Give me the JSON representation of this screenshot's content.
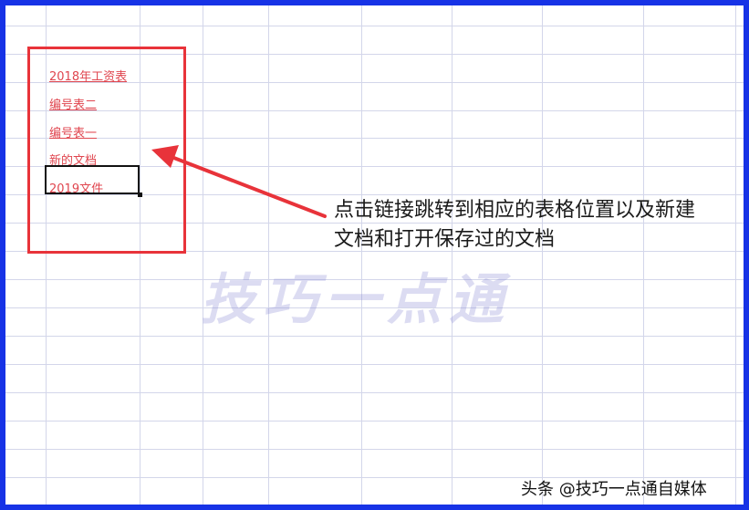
{
  "sheet": {
    "links": [
      {
        "label": "2018年工资表"
      },
      {
        "label": "编号表二"
      },
      {
        "label": "编号表一"
      },
      {
        "label": "新的文档"
      },
      {
        "label": "2019文件"
      }
    ]
  },
  "annotation": {
    "line1": "点击链接跳转到相应的表格位置以及新建",
    "line2": "文档和打开保存过的文档"
  },
  "watermark": {
    "text": "技巧一点通"
  },
  "credit": {
    "text": "头条 @技巧一点通自媒体"
  },
  "colors": {
    "frame": "#1733e6",
    "highlight_box": "#e8333a",
    "link": "#e0464f",
    "grid": "#d3d6ea"
  }
}
